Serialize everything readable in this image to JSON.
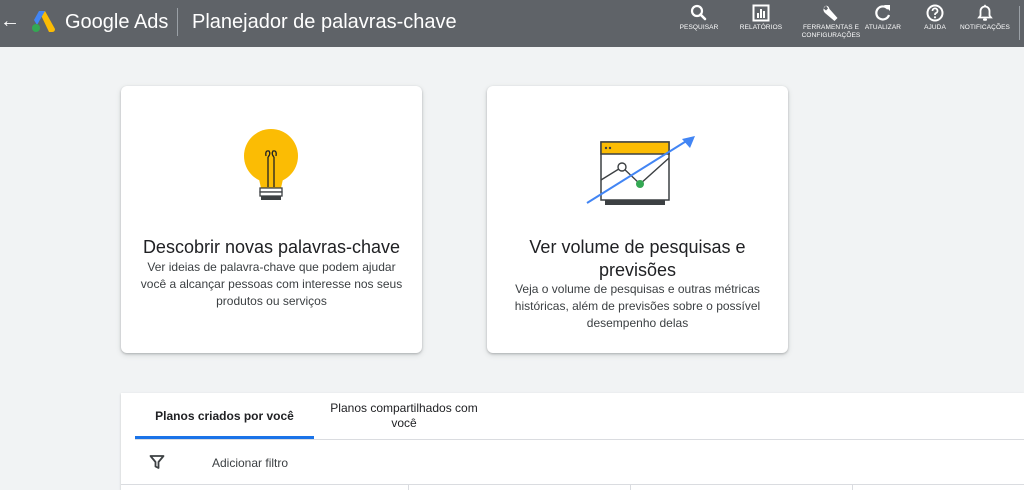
{
  "header": {
    "back_icon": "arrow-back-icon",
    "logo_icon": "google-ads-logo",
    "brand": "Google Ads",
    "title": "Planejador de palavras-chave",
    "tools": [
      {
        "label": "PESQUISAR",
        "icon": "search-icon"
      },
      {
        "label": "RELATÓRIOS",
        "icon": "reports-icon"
      },
      {
        "label_line1": "FERRAMENTAS E",
        "label_line2": "CONFIGURAÇÕES",
        "icon": "wrench-icon"
      },
      {
        "label": "ATUALIZAR",
        "icon": "refresh-icon"
      },
      {
        "label": "AJUDA",
        "icon": "help-icon"
      },
      {
        "label": "NOTIFICAÇÕES",
        "icon": "bell-icon"
      }
    ]
  },
  "cards": [
    {
      "icon": "lightbulb-icon",
      "title": "Descobrir novas palavras-chave",
      "description": "Ver ideias de palavra-chave que podem ajudar você a alcançar pessoas com interesse nos seus produtos ou serviços"
    },
    {
      "icon": "trend-chart-icon",
      "title": "Ver volume de pesquisas e previsões",
      "description": "Veja o volume de pesquisas e outras métricas históricas, além de previsões sobre o possível desempenho delas"
    }
  ],
  "plans": {
    "tabs": [
      {
        "label": "Planos criados por você",
        "selected": true
      },
      {
        "label": "Planos compartilhados com você",
        "selected": false
      }
    ],
    "filter_icon": "filter-icon",
    "add_filter_label": "Adicionar filtro"
  },
  "colors": {
    "topbar": "#5f6368",
    "page_bg": "#f1f3f4",
    "accent": "#1a73e8",
    "bulb": "#fbbc04",
    "green_point": "#34a853"
  }
}
